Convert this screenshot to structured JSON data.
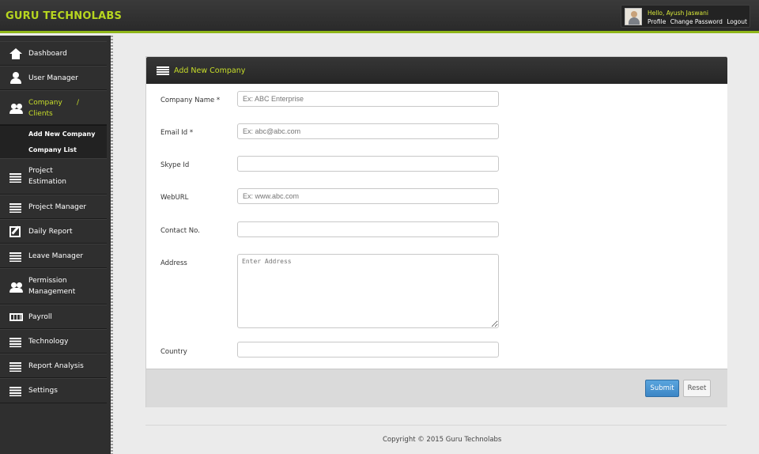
{
  "header": {
    "brand": "GURU TECHNOLABS",
    "greeting": "Hello, Ayush Jaswani",
    "links": [
      "Profile",
      "Change Password",
      "Logout"
    ]
  },
  "sidebar": {
    "items": [
      {
        "label": "Dashboard",
        "icon": "home-icon"
      },
      {
        "label": "User Manager",
        "icon": "user-icon"
      },
      {
        "label": "Company",
        "label2": "Clients",
        "icon": "users-icon",
        "separator": "/"
      },
      {
        "label": "Project",
        "label2": "Estimation",
        "icon": "list-icon"
      },
      {
        "label": "Project Manager",
        "icon": "list-icon"
      },
      {
        "label": "Daily Report",
        "icon": "edit-icon"
      },
      {
        "label": "Leave Manager",
        "icon": "list-icon"
      },
      {
        "label": "Permission",
        "label2": "Management",
        "icon": "group-icon"
      },
      {
        "label": "Payroll",
        "icon": "book-icon"
      },
      {
        "label": "Technology",
        "icon": "list-icon"
      },
      {
        "label": "Report Analysis",
        "icon": "list-icon"
      },
      {
        "label": "Settings",
        "icon": "list-icon"
      }
    ],
    "submenu": [
      "Add New Company",
      "Company List"
    ]
  },
  "panel": {
    "title": "Add New Company",
    "fields": [
      {
        "label": "Company Name",
        "required": "*",
        "placeholder": "Ex: ABC Enterprise"
      },
      {
        "label": "Email Id",
        "required": "*",
        "placeholder": "Ex: abc@abc.com"
      },
      {
        "label": "Skype Id",
        "placeholder": ""
      },
      {
        "label": "WebURL",
        "placeholder": "Ex: www.abc.com"
      },
      {
        "label": "Contact No.",
        "placeholder": ""
      },
      {
        "label": "Address",
        "placeholder": "Enter Address"
      },
      {
        "label": "Country",
        "placeholder": ""
      }
    ],
    "submit_label": "Submit",
    "reset_label": "Reset"
  },
  "footer": {
    "copyright": "Copyright © 2015 Guru Technolabs"
  },
  "colors": {
    "accent": "#c8de2a",
    "header_bg": "#2f2f2f",
    "primary_button": "#4a96d2"
  }
}
